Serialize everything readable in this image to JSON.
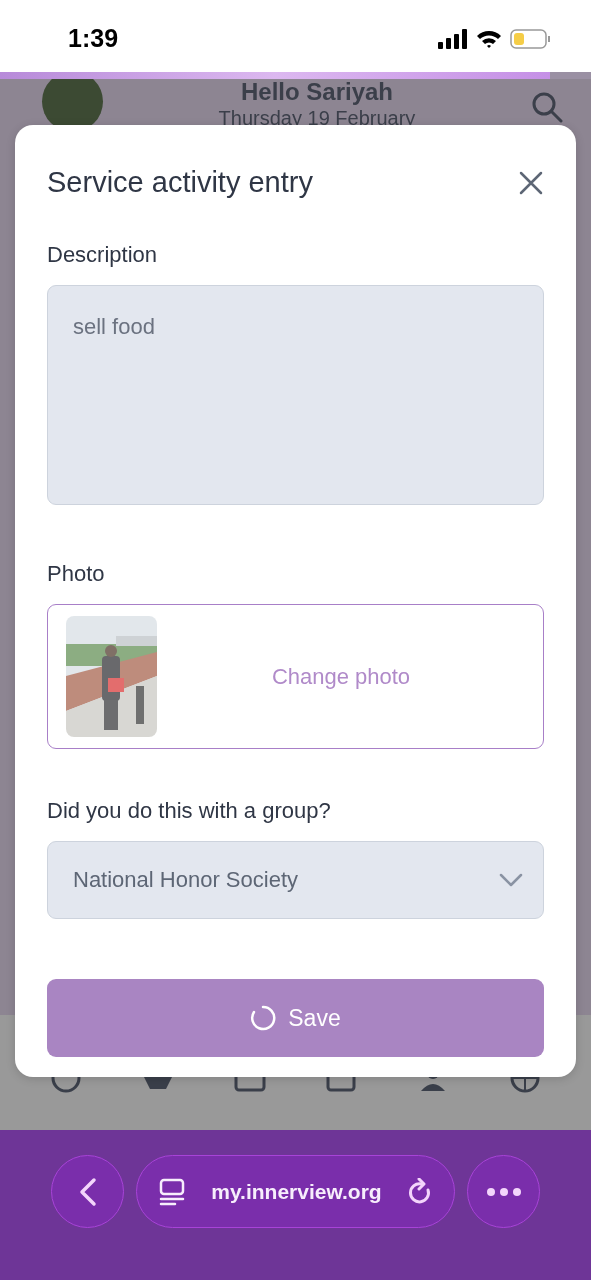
{
  "status_bar": {
    "time": "1:39"
  },
  "page": {
    "loading_bar": {
      "level": 0.93
    },
    "greeting": "Hello Sariyah",
    "date": "Thursday 19 February"
  },
  "modal": {
    "title": "Service activity entry",
    "fields": [
      {
        "kind": "textarea",
        "label": "Description",
        "value": "sell food"
      },
      {
        "label": "Photo",
        "action": "Change photo"
      },
      {
        "kind": "select",
        "label": "Did you do this with a group?",
        "value": "National Honor Society"
      }
    ],
    "save_button": {
      "label": "Save",
      "loading": true
    }
  },
  "browser": {
    "url": "my.innerview.org"
  }
}
